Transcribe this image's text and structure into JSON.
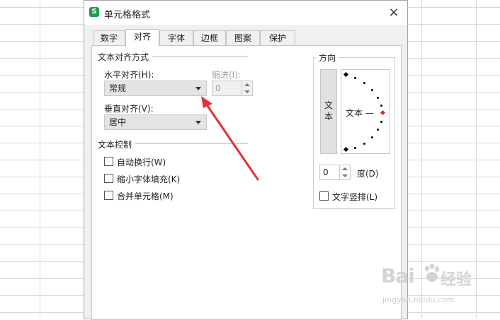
{
  "dialog": {
    "title": "单元格格式",
    "app_icon": "S",
    "close_label": "×"
  },
  "tabs": [
    "数字",
    "对齐",
    "字体",
    "边框",
    "图案",
    "保护"
  ],
  "active_tab": "对齐",
  "alignment": {
    "group_title": "文本对齐方式",
    "horizontal_label": "水平对齐(H):",
    "horizontal_value": "常规",
    "indent_label": "缩进(I):",
    "indent_value": "0",
    "vertical_label": "垂直对齐(V):",
    "vertical_value": "居中"
  },
  "text_control": {
    "group_title": "文本控制",
    "options": [
      {
        "label": "自动换行(W)",
        "checked": false
      },
      {
        "label": "缩小字体填充(K)",
        "checked": false
      },
      {
        "label": "合并单元格(M)",
        "checked": false
      }
    ]
  },
  "orientation": {
    "group_title": "方向",
    "vertical_text_chars": [
      "文",
      "本"
    ],
    "dial_label": "文本 —",
    "degrees_value": "0",
    "degrees_label": "度(D)",
    "vertical_text_checkbox": "文字竖排(L)"
  },
  "annotation": {
    "arrow_color": "#e03333",
    "points_to": "horizontal-align-select"
  },
  "watermark": {
    "logo": "Bai",
    "brand_cn": "经验",
    "url": "jingyan.baidu.com"
  },
  "colors": {
    "accent_green": "#1f9b4e",
    "dial_marker": "#c0332b"
  }
}
